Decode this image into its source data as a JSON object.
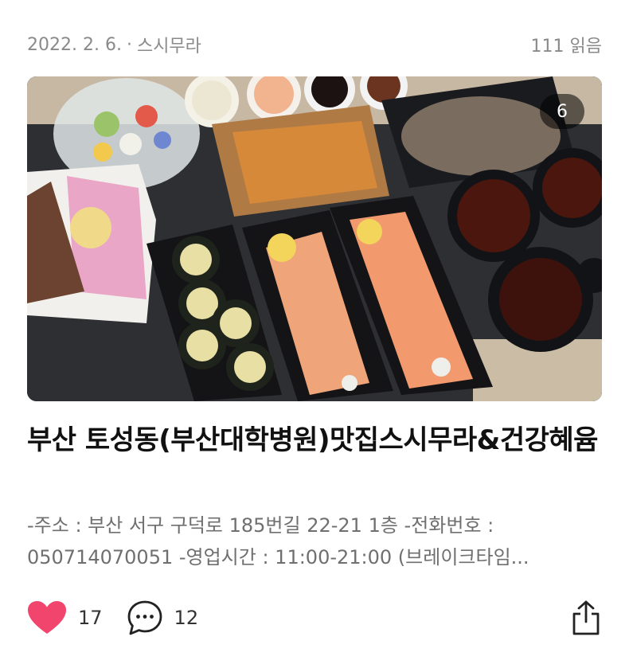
{
  "post": {
    "date": "2022. 2. 6.",
    "separator": "·",
    "category": "스시무라",
    "read_count": "111 읽음",
    "photo_count": "6",
    "title": "부산 토성동(부산대학병원)맛집스시무라&건강혜윰",
    "excerpt_line1": "-주소 : 부산 서구 구덕로 185번길 22-21 1층 -전화번호 :",
    "excerpt_line2": "050714070051 -영업시간 : 11:00-21:00 (브레이크타임..."
  },
  "actions": {
    "like_count": "17",
    "comment_count": "12",
    "like_icon": "heart-icon",
    "comment_icon": "speech-bubble-icon",
    "share_icon": "share-icon"
  },
  "colors": {
    "heart": "#f2456e",
    "meta_text": "#8a8a8a",
    "excerpt_text": "#6f6f6f"
  }
}
